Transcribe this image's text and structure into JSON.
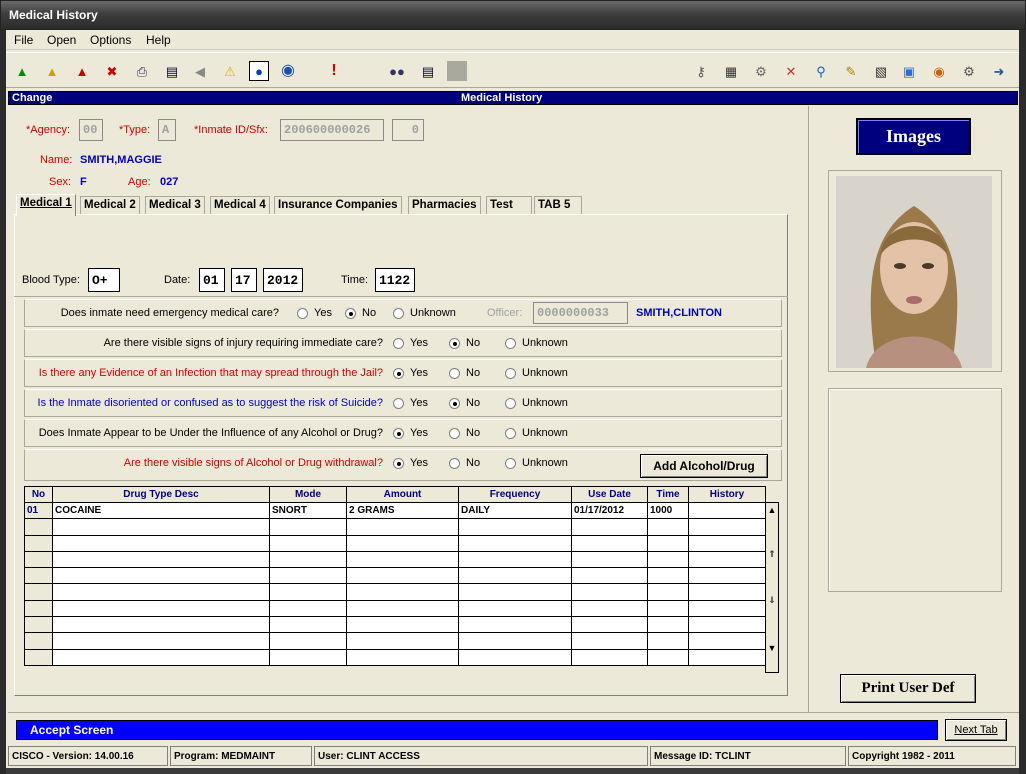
{
  "window": {
    "title": "Medical History"
  },
  "menu": [
    "File",
    "Open",
    "Options",
    "Help"
  ],
  "header": {
    "mode": "Change",
    "title": "Medical History"
  },
  "inmate": {
    "agency_label": "*Agency:",
    "agency": "00",
    "type_label": "*Type:",
    "type": "A",
    "id_label": "*Inmate ID/Sfx:",
    "id": "200600000026",
    "sfx": "0",
    "name_label": "Name:",
    "name": "SMITH,MAGGIE",
    "sex_label": "Sex:",
    "sex": "F",
    "age_label": "Age:",
    "age": "027"
  },
  "tabs": [
    "Medical 1",
    "Medical 2",
    "Medical 3",
    "Medical 4",
    "Insurance Companies",
    "Pharmacies",
    "Test",
    "TAB 5"
  ],
  "vitals": {
    "blood_label": "Blood Type:",
    "blood": "O+",
    "date_label": "Date:",
    "month": "01",
    "day": "17",
    "year": "2012",
    "time_label": "Time:",
    "time": "1122"
  },
  "radio_labels": {
    "yes": "Yes",
    "no": "No",
    "unknown": "Unknown"
  },
  "questions": [
    {
      "text": "Does inmate need emergency medical care?",
      "color": "black",
      "answer": "No"
    },
    {
      "text": "Are there visible signs of injury requiring immediate care?",
      "color": "black",
      "answer": "No"
    },
    {
      "text": "Is there any Evidence of an Infection that may spread through the Jail?",
      "color": "red",
      "answer": "Yes"
    },
    {
      "text": "Is the Inmate disoriented or confused as to suggest the risk of Suicide?",
      "color": "blue",
      "answer": "No"
    },
    {
      "text": "Does Inmate Appear to be Under the Influence of any Alcohol or Drug?",
      "color": "black",
      "answer": "Yes"
    },
    {
      "text": "Are there visible signs of Alcohol or Drug withdrawal?",
      "color": "red",
      "answer": "Yes"
    }
  ],
  "officer": {
    "label": "Officer:",
    "id": "0000000033",
    "name": "SMITH,CLINTON"
  },
  "buttons": {
    "add_alcohol": "Add Alcohol/Drug",
    "images": "Images",
    "print_user_def": "Print User Def",
    "next_tab": "Next Tab"
  },
  "grid": {
    "columns": [
      "No",
      "Drug Type Desc",
      "Mode",
      "Amount",
      "Frequency",
      "Use Date",
      "Time",
      "History"
    ],
    "rows": [
      [
        "01",
        "COCAINE",
        "SNORT",
        "2 GRAMS",
        "DAILY",
        "01/17/2012",
        "1000",
        ""
      ]
    ]
  },
  "message": "Accept Screen",
  "status": {
    "version": "CISCO - Version: 14.00.16",
    "program": "Program: MEDMAINT",
    "user": "User: CLINT ACCESS",
    "message_id": "Message ID: TCLINT",
    "copyright": "Copyright 1982 - 2011"
  },
  "colors": {
    "header_blue": "#00007f",
    "message_blue": "#0000ff",
    "required_red": "#d00000"
  }
}
